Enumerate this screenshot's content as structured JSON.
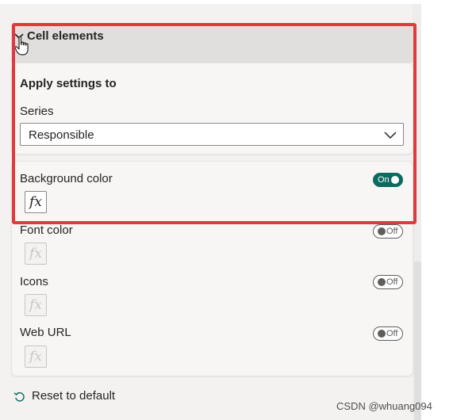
{
  "group": {
    "title": "Cell elements"
  },
  "apply_settings": {
    "title": "Apply settings to",
    "series_label": "Series",
    "series_value": "Responsible"
  },
  "elements": [
    {
      "label": "Background color",
      "toggle": "On",
      "fx": "fx"
    },
    {
      "label": "Font color",
      "toggle": "Off",
      "fx": "fx"
    },
    {
      "label": "Icons",
      "toggle": "Off",
      "fx": "fx"
    },
    {
      "label": "Web URL",
      "toggle": "Off",
      "fx": "fx"
    }
  ],
  "footer": {
    "reset_label": "Reset to default"
  },
  "watermark": "CSDN @whuang094",
  "colors": {
    "accent_on": "#0b6b5e",
    "highlight": "#e03a3e",
    "pane_bg": "#f3f2f1"
  },
  "icons": [
    "chevron-down-icon",
    "hand-cursor-icon",
    "dropdown-chevron-icon",
    "fx-icon",
    "reset-icon"
  ]
}
